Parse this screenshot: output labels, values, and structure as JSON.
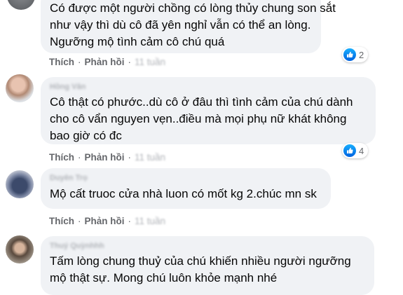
{
  "comments": [
    {
      "author": "",
      "lines": [
        "Có được một người chồng có lòng thủy chung son sắt",
        "như vậy thì dù cô đã yên nghỉ vẫn có thể an lòng.",
        "Ngưỡng mộ tình cảm cô chú quá"
      ],
      "like_label": "Thích",
      "reply_label": "Phản hồi",
      "time": "11 tuần",
      "reaction_count": "2"
    },
    {
      "author": "Hồng Vân",
      "lines": [
        "Cô thật có phước..dù cô ở đâu thì tình cảm của chú dành",
        "cho cô vẩn nguyen vẹn..điều mà mọi phụ nữ khát không",
        "bao giờ có đc"
      ],
      "like_label": "Thích",
      "reply_label": "Phản hồi",
      "time": "11 tuần",
      "reaction_count": "4"
    },
    {
      "author": "Duyên Trọ",
      "lines": [
        "Mộ cất truoc cửa nhà luon có mốt kg 2.chúc mn sk"
      ],
      "like_label": "Thích",
      "reply_label": "Phản hồi",
      "time": "11 tuần"
    },
    {
      "author": "Thuý Quỳnhhh",
      "lines": [
        "Tấm lòng chung thuỷ của chú khiến nhiều người ngưỡng",
        "mộ thật sự. Mong chú luôn khỏe mạnh nhé"
      ]
    }
  ],
  "icons": {
    "reaction": "like-icon"
  },
  "colors": {
    "bubble": "#f0f2f5",
    "action_text": "#65676b",
    "like_blue": "#0866ff"
  }
}
